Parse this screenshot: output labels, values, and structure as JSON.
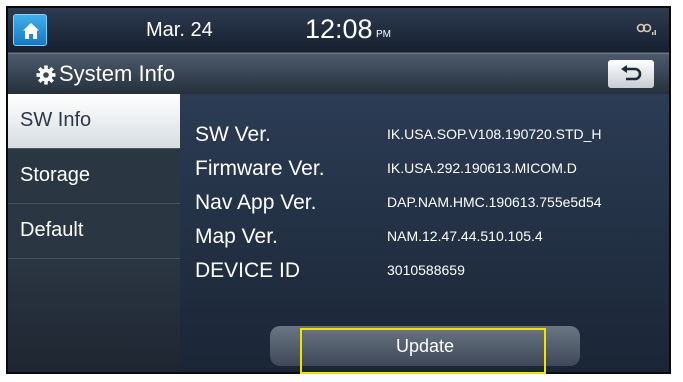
{
  "status_bar": {
    "date": "Mar. 24",
    "time": "12:08",
    "ampm": "PM"
  },
  "title_bar": {
    "title": "System Info"
  },
  "sidebar": {
    "items": [
      {
        "label": "SW Info",
        "active": true
      },
      {
        "label": "Storage",
        "active": false
      },
      {
        "label": "Default",
        "active": false
      }
    ]
  },
  "info": {
    "rows": [
      {
        "label": "SW Ver.",
        "value": "IK.USA.SOP.V108.190720.STD_H"
      },
      {
        "label": "Firmware Ver.",
        "value": "IK.USA.292.190613.MICOM.D"
      },
      {
        "label": "Nav App Ver.",
        "value": "DAP.NAM.HMC.190613.755e5d54"
      },
      {
        "label": "Map Ver.",
        "value": "NAM.12.47.44.510.105.4"
      },
      {
        "label": "DEVICE ID",
        "value": "3010588659"
      }
    ]
  },
  "update_button": {
    "label": "Update"
  },
  "icons": {
    "home": "home-icon",
    "settings": "gear-icon",
    "back": "back-arrow-icon",
    "signal": "signal-icon"
  },
  "colors": {
    "highlight": "#f2e200",
    "home_button": "#1f8fd6",
    "active_tab": "#ffffff"
  }
}
